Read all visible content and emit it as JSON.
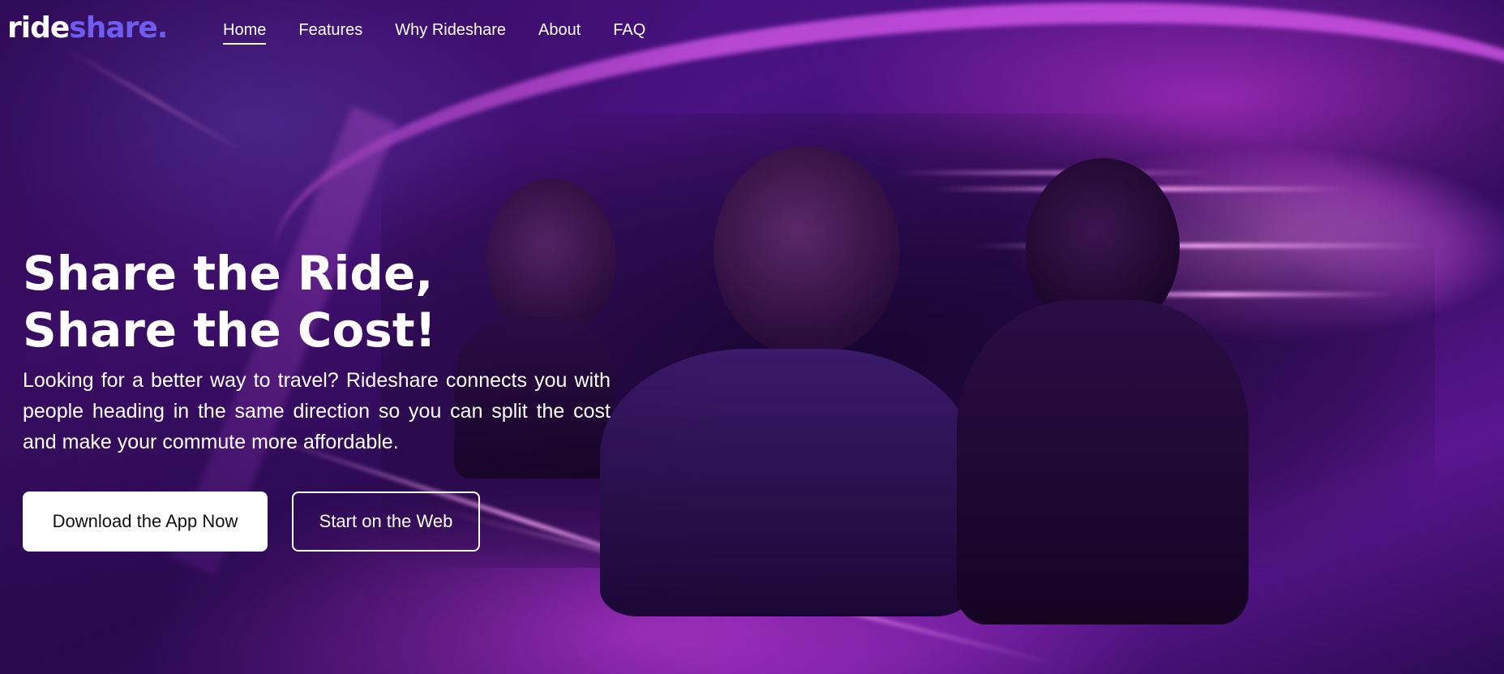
{
  "brand": {
    "logo_primary": "ride",
    "logo_accent": "share.",
    "accent_color": "#6f5cf0"
  },
  "nav": {
    "items": [
      {
        "label": "Home",
        "active": true
      },
      {
        "label": "Features",
        "active": false
      },
      {
        "label": "Why Rideshare",
        "active": false
      },
      {
        "label": "About",
        "active": false
      },
      {
        "label": "FAQ",
        "active": false
      }
    ]
  },
  "hero": {
    "headline_line1": "Share the Ride,",
    "headline_line2": "Share the Cost!",
    "description": "Looking for a better way to travel? Rideshare connects you with people heading in the same direction so you can split the cost and make your commute more affordable.",
    "primary_cta": "Download the App Now",
    "secondary_cta": "Start on the Web",
    "background_color": "#3a0f6e"
  }
}
